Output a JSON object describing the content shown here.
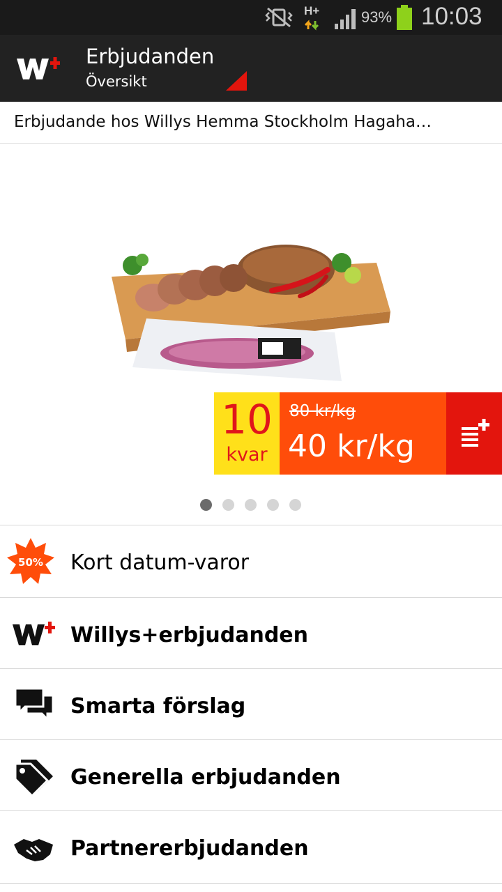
{
  "status_bar": {
    "network": "H+",
    "battery_percent": "93%",
    "time": "10:03",
    "icons": [
      "vibrate-icon",
      "network-activity-icon",
      "signal-icon",
      "battery-icon"
    ]
  },
  "action_bar": {
    "title": "Erbjudanden",
    "subtitle": "Översikt",
    "logo": "willys-plus-logo",
    "colors": {
      "background": "#222222",
      "accent": "#e3150d"
    }
  },
  "store": {
    "text": "Erbjudande hos Willys Hemma Stockholm Hagaha…"
  },
  "offer": {
    "quantity": "10",
    "quantity_label": "kvar",
    "old_price": "80 kr/kg",
    "new_price": "40 kr/kg",
    "add_icon": "add-to-list-icon",
    "colors": {
      "quantity_bg": "#ffe01a",
      "price_bg": "#ff4d0a",
      "add_bg": "#e3150d"
    }
  },
  "carousel": {
    "total_pages": 5,
    "active_page": 1
  },
  "menu": {
    "items": [
      {
        "label": "Kort datum-varor",
        "icon": "discount-50-badge-icon",
        "badge": "50%"
      },
      {
        "label": "Willys+erbjudanden",
        "icon": "willys-plus-icon"
      },
      {
        "label": "Smarta förslag",
        "icon": "chat-bubbles-icon"
      },
      {
        "label": "Generella erbjudanden",
        "icon": "price-tags-icon"
      },
      {
        "label": "Partnererbjudanden",
        "icon": "handshake-icon"
      }
    ]
  }
}
